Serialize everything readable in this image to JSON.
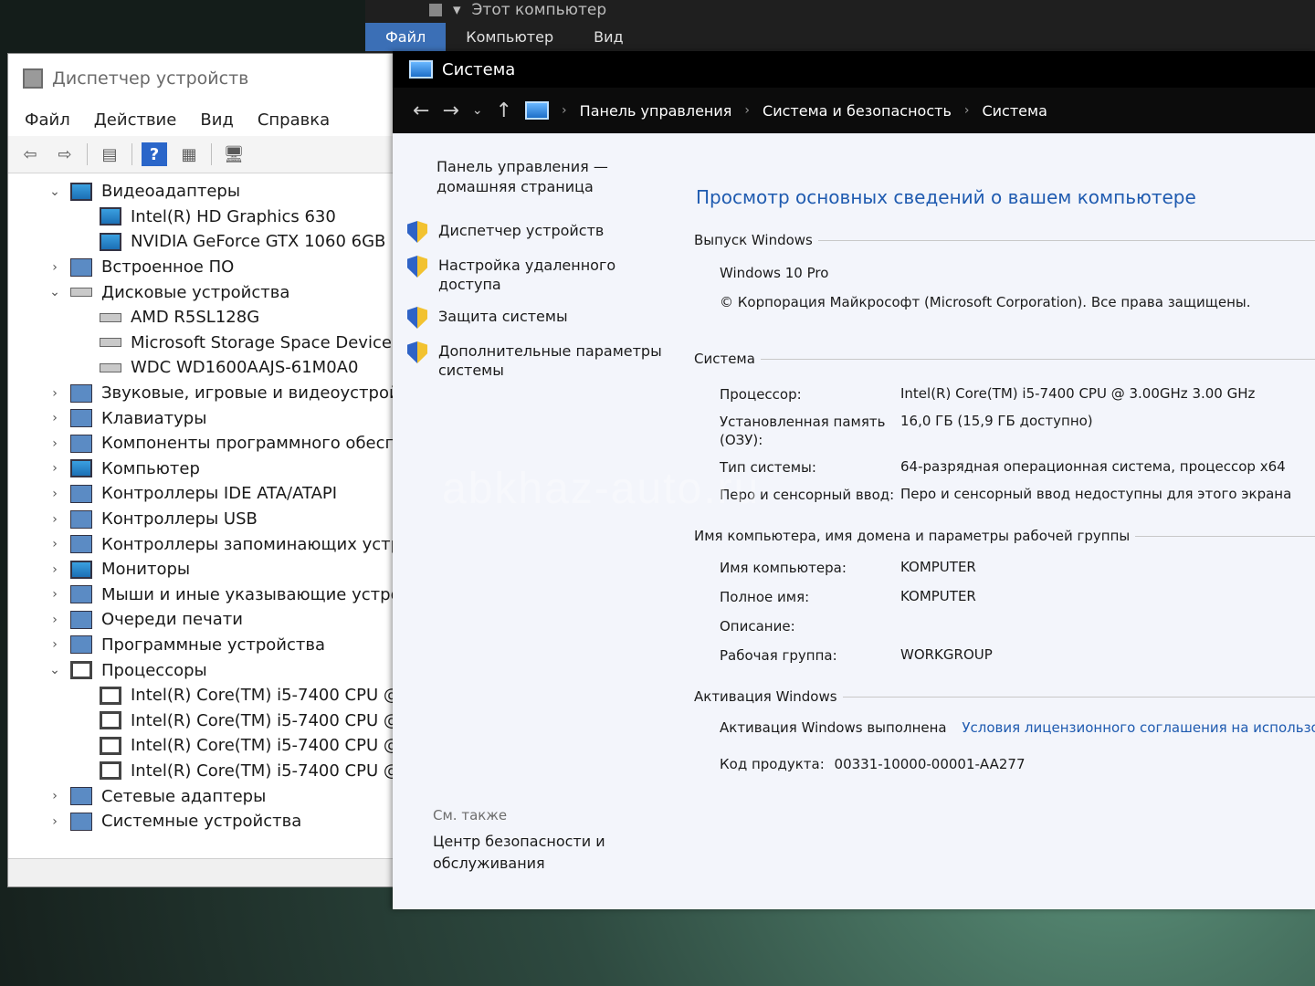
{
  "explorer": {
    "title": "Этот компьютер",
    "ribbon_tabs": [
      "Файл",
      "Компьютер",
      "Вид"
    ]
  },
  "device_manager": {
    "title": "Диспетчер устройств",
    "menu": [
      "Файл",
      "Действие",
      "Вид",
      "Справка"
    ],
    "tree": [
      {
        "label": "Видеоадаптеры",
        "expanded": true,
        "icon": "display-icon",
        "children": [
          "Intel(R) HD Graphics 630",
          "NVIDIA GeForce GTX 1060 6GB"
        ]
      },
      {
        "label": "Встроенное ПО",
        "expanded": false,
        "icon": "firmware-icon"
      },
      {
        "label": "Дисковые устройства",
        "expanded": true,
        "icon": "disk-icon",
        "children": [
          "AMD R5SL128G",
          "Microsoft Storage Space Device",
          "WDC WD1600AAJS-61M0A0"
        ]
      },
      {
        "label": "Звуковые, игровые и видеоустройс",
        "expanded": false,
        "icon": "speaker-icon"
      },
      {
        "label": "Клавиатуры",
        "expanded": false,
        "icon": "keyboard-icon"
      },
      {
        "label": "Компоненты программного обесп",
        "expanded": false,
        "icon": "software-icon"
      },
      {
        "label": "Компьютер",
        "expanded": false,
        "icon": "computer-icon"
      },
      {
        "label": "Контроллеры IDE ATA/ATAPI",
        "expanded": false,
        "icon": "ide-icon"
      },
      {
        "label": "Контроллеры USB",
        "expanded": false,
        "icon": "usb-icon"
      },
      {
        "label": "Контроллеры запоминающих устр",
        "expanded": false,
        "icon": "storage-controller-icon"
      },
      {
        "label": "Мониторы",
        "expanded": false,
        "icon": "monitor-icon"
      },
      {
        "label": "Мыши и иные указывающие устро",
        "expanded": false,
        "icon": "mouse-icon"
      },
      {
        "label": "Очереди печати",
        "expanded": false,
        "icon": "printer-icon"
      },
      {
        "label": "Программные устройства",
        "expanded": false,
        "icon": "software-device-icon"
      },
      {
        "label": "Процессоры",
        "expanded": true,
        "icon": "processor-icon",
        "children": [
          "Intel(R) Core(TM) i5-7400 CPU @",
          "Intel(R) Core(TM) i5-7400 CPU @",
          "Intel(R) Core(TM) i5-7400 CPU @",
          "Intel(R) Core(TM) i5-7400 CPU @"
        ]
      },
      {
        "label": "Сетевые адаптеры",
        "expanded": false,
        "icon": "network-icon"
      },
      {
        "label": "Системные устройства",
        "expanded": false,
        "icon": "system-device-icon"
      }
    ]
  },
  "system": {
    "window_title": "Система",
    "breadcrumb": [
      "Панель управления",
      "Система и безопасность",
      "Система"
    ],
    "left": {
      "home": "Панель управления — домашняя страница",
      "links": [
        "Диспетчер устройств",
        "Настройка удаленного доступа",
        "Защита системы",
        "Дополнительные параметры системы"
      ],
      "see_also_label": "См. также",
      "see_also_link": "Центр безопасности и обслуживания"
    },
    "heading": "Просмотр основных сведений о вашем компьютере",
    "windows_edition": {
      "title": "Выпуск Windows",
      "edition": "Windows 10 Pro",
      "copyright": "© Корпорация Майкрософт (Microsoft Corporation). Все права защищены."
    },
    "system_section": {
      "title": "Система",
      "rows": [
        {
          "label": "Процессор:",
          "value": "Intel(R) Core(TM) i5-7400 CPU @ 3.00GHz   3.00 GHz"
        },
        {
          "label": "Установленная память (ОЗУ):",
          "value": "16,0 ГБ (15,9 ГБ доступно)"
        },
        {
          "label": "Тип системы:",
          "value": "64-разрядная операционная система, процессор x64"
        },
        {
          "label": "Перо и сенсорный ввод:",
          "value": "Перо и сенсорный ввод недоступны для этого экрана"
        }
      ]
    },
    "computer_name_section": {
      "title": "Имя компьютера, имя домена и параметры рабочей группы",
      "rows": [
        {
          "label": "Имя компьютера:",
          "value": "KOMPUTER"
        },
        {
          "label": "Полное имя:",
          "value": "KOMPUTER"
        },
        {
          "label": "Описание:",
          "value": ""
        },
        {
          "label": "Рабочая группа:",
          "value": "WORKGROUP"
        }
      ]
    },
    "activation": {
      "title": "Активация Windows",
      "status": "Активация Windows выполнена",
      "license_link": "Условия лицензионного соглашения на использование програм",
      "product_key_label": "Код продукта:",
      "product_key": "00331-10000-00001-AA277"
    }
  },
  "watermark": "abkhaz-auto.ru"
}
